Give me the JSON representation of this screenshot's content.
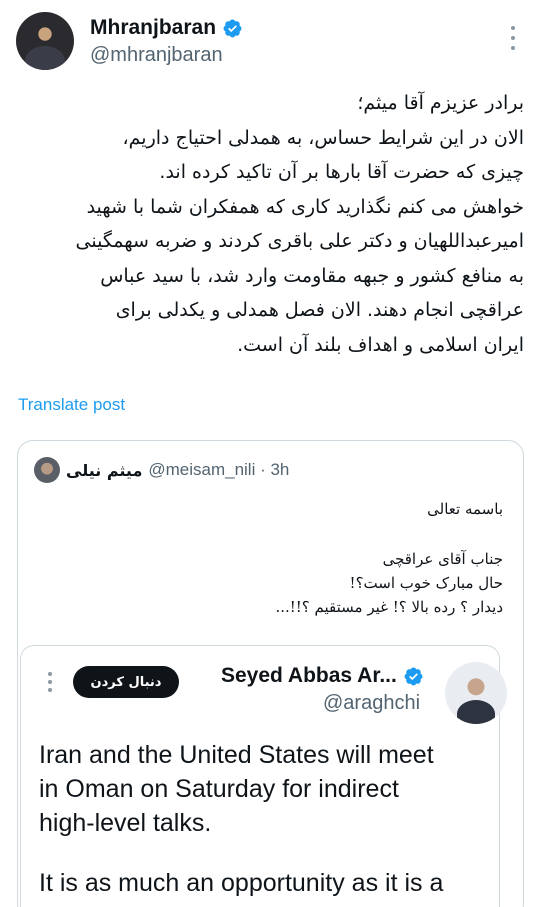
{
  "post": {
    "author": {
      "display_name": "Mhranjbaran",
      "handle": "@mhranjbaran",
      "verified": true
    },
    "lines": [
      "برادر عزیزم آقا میثم؛",
      "الان در این شرایط حساس، به همدلی احتیاج داریم،",
      "چیزی که حضرت آقا بارها بر آن تاکید کرده اند.",
      "خواهش می کنم نگذارید کاری که همفکران شما با شهید",
      "امیرعبداللهیان و دکتر علی باقری کردند و ضربه سهمگینی",
      "به منافع کشور و جبهه مقاومت وارد شد، با سید عباس",
      "عراقچی انجام دهند. الان فصل همدلی و یکدلی برای",
      "ایران اسلامی و اهداف بلند آن است."
    ],
    "translate_label": "Translate post"
  },
  "quote": {
    "author_name": "میثم نیلی",
    "handle_time": "@meisam_nili · 3h",
    "lines": [
      "باسمه تعالی",
      "جناب آقای عراقچی",
      "حال مبارک خوب است؟!",
      "دیدار ؟  رده بالا ؟!  غیر مستقیم ؟!!..."
    ],
    "embedded": {
      "author_name": "Seyed Abbas Ar...",
      "handle": "@araghchi",
      "follow_label": "دنبال کردن",
      "text_1": "Iran and the United States will meet\nin Oman on Saturday for indirect\nhigh-level talks.",
      "text_2": "It is as much an opportunity as it is a"
    }
  },
  "colors": {
    "verified": "#1d9bf0",
    "link": "#1d9bf0",
    "secondary": "#536471",
    "border": "#cfd9de"
  }
}
